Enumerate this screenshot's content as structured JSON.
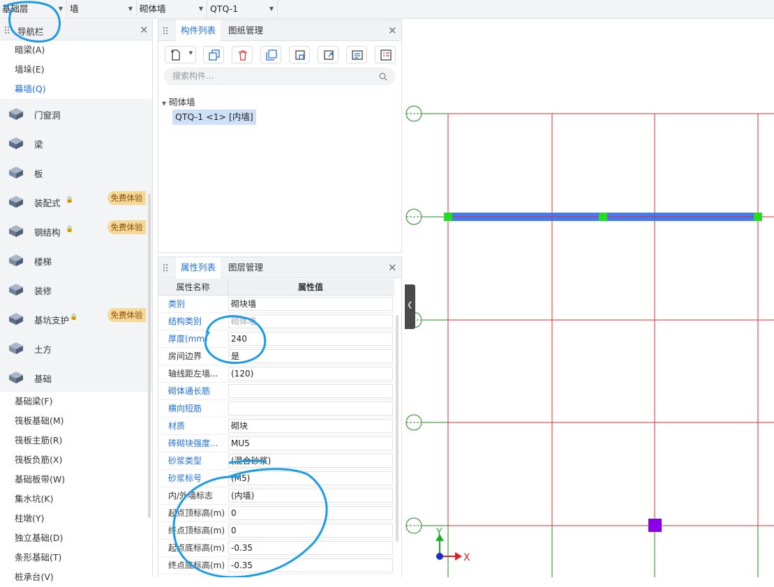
{
  "topbar": {
    "floor": "基础层",
    "category": "墙",
    "type": "砌体墙",
    "component": "QTQ-1"
  },
  "nav": {
    "title": "导航栏",
    "subitems_top": [
      "暗梁(A)",
      "墙垛(E)",
      "幕墙(Q)"
    ],
    "categories": [
      {
        "label": "门窗洞",
        "icon": "door-window-icon"
      },
      {
        "label": "梁",
        "icon": "beam-icon"
      },
      {
        "label": "板",
        "icon": "slab-icon"
      },
      {
        "label": "装配式",
        "icon": "prefab-icon",
        "locked": true,
        "badge": "免费体验"
      },
      {
        "label": "钢结构",
        "icon": "steel-structure-icon",
        "locked": true,
        "badge": "免费体验"
      },
      {
        "label": "楼梯",
        "icon": "stairs-icon"
      },
      {
        "label": "装修",
        "icon": "decoration-icon"
      },
      {
        "label": "基坑支护",
        "icon": "foundation-pit-icon",
        "locked": true,
        "badge": "免费体验"
      },
      {
        "label": "土方",
        "icon": "earthwork-icon"
      },
      {
        "label": "基础",
        "icon": "foundation-icon"
      }
    ],
    "subitems_bottom": [
      "基础梁(F)",
      "筏板基础(M)",
      "筏板主筋(R)",
      "筏板负筋(X)",
      "基础板带(W)",
      "集水坑(K)",
      "柱墩(Y)",
      "独立基础(D)",
      "条形基础(T)",
      "桩承台(V)"
    ]
  },
  "component_panel": {
    "tab_active": "构件列表",
    "tab_other": "图纸管理",
    "search_placeholder": "搜索构件...",
    "tree_group": "砌体墙",
    "tree_item": "QTQ-1 <1> [内墙]"
  },
  "property_panel": {
    "tab_active": "属性列表",
    "tab_other": "图层管理",
    "col_name": "属性名称",
    "col_value": "属性值",
    "rows": [
      {
        "name": "类别",
        "value": "砌块墙",
        "blue": true
      },
      {
        "name": "结构类别",
        "value": "砌体墙",
        "blue": true,
        "gray": true
      },
      {
        "name": "厚度(mm)",
        "value": "240",
        "blue": true
      },
      {
        "name": "房间边界",
        "value": "是",
        "blue": false
      },
      {
        "name": "轴线距左墙...",
        "value": "(120)",
        "blue": false
      },
      {
        "name": "砌体通长筋",
        "value": "",
        "blue": true
      },
      {
        "name": "横向短筋",
        "value": "",
        "blue": true
      },
      {
        "name": "材质",
        "value": "砌块",
        "blue": true
      },
      {
        "name": "砖砌块强度...",
        "value": "MU5",
        "blue": true
      },
      {
        "name": "砂浆类型",
        "value": "(混合砂浆)",
        "blue": true
      },
      {
        "name": "砂浆标号",
        "value": "(M5)",
        "blue": true
      },
      {
        "name": "内/外墙标志",
        "value": "(内墙)",
        "blue": false
      },
      {
        "name": "起点顶标高(m)",
        "value": "0",
        "blue": false
      },
      {
        "name": "终点顶标高(m)",
        "value": "0",
        "blue": false
      },
      {
        "name": "起点底标高(m)",
        "value": "-0.35",
        "blue": false
      },
      {
        "name": "终点底标高(m)",
        "value": "-0.35",
        "blue": false
      }
    ]
  },
  "canvas": {
    "axis_x": "X",
    "axis_y": "Y"
  },
  "colors": {
    "accent": "#1f6fe0",
    "grid_red": "#e0282e",
    "grid_green": "#1a8a1a",
    "wall_blue": "#2f6df0",
    "node_green": "#22dd22",
    "marker_purple": "#8a00e6",
    "annotation": "#1a9be6"
  }
}
